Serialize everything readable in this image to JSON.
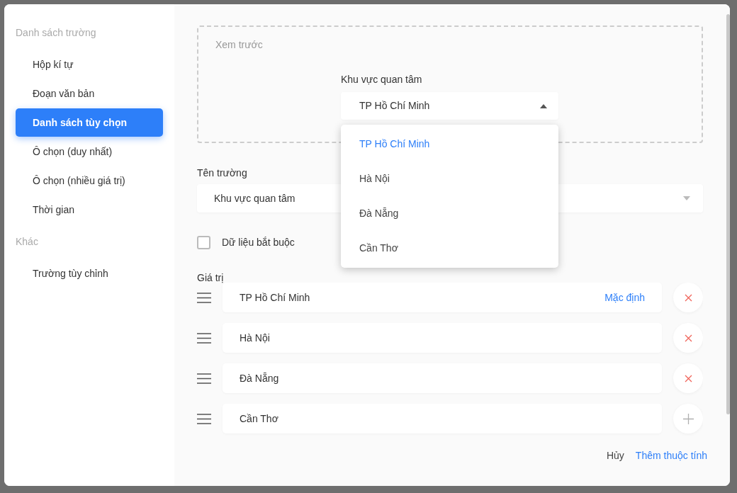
{
  "sidebar": {
    "sections": [
      {
        "title": "Danh sách trường",
        "items": [
          {
            "label": "Hộp kí tự",
            "selected": false
          },
          {
            "label": "Đoạn văn bản",
            "selected": false
          },
          {
            "label": "Danh sách tùy chọn",
            "selected": true
          },
          {
            "label": "Ô chọn (duy nhất)",
            "selected": false
          },
          {
            "label": "Ô chọn (nhiều giá trị)",
            "selected": false
          },
          {
            "label": "Thời gian",
            "selected": false
          }
        ]
      },
      {
        "title": "Khác",
        "items": [
          {
            "label": "Trường tùy chỉnh",
            "selected": false
          }
        ]
      }
    ]
  },
  "preview": {
    "title": "Xem trước",
    "field_label": "Khu vực quan tâm",
    "value": "TP Hồ Chí Minh",
    "expanded": true,
    "options": [
      {
        "label": "TP Hồ Chí Minh",
        "selected": true
      },
      {
        "label": "Hà Nội",
        "selected": false
      },
      {
        "label": "Đà Nẵng",
        "selected": false
      },
      {
        "label": "Cần Thơ",
        "selected": false
      }
    ]
  },
  "field_name": {
    "label": "Tên trường",
    "value": "Khu vực quan tâm"
  },
  "required": {
    "label": "Dữ liệu bắt buộc",
    "checked": false
  },
  "values": {
    "label": "Giá trị",
    "items": [
      {
        "value": "TP Hồ Chí Minh",
        "default_label": "Mặc định",
        "kind": "remove"
      },
      {
        "value": "Hà Nội",
        "kind": "remove"
      },
      {
        "value": "Đà Nẵng",
        "kind": "remove"
      },
      {
        "value": "Cần Thơ",
        "kind": "add"
      }
    ]
  },
  "footer": {
    "cancel": "Hủy",
    "submit": "Thêm thuộc tính"
  }
}
